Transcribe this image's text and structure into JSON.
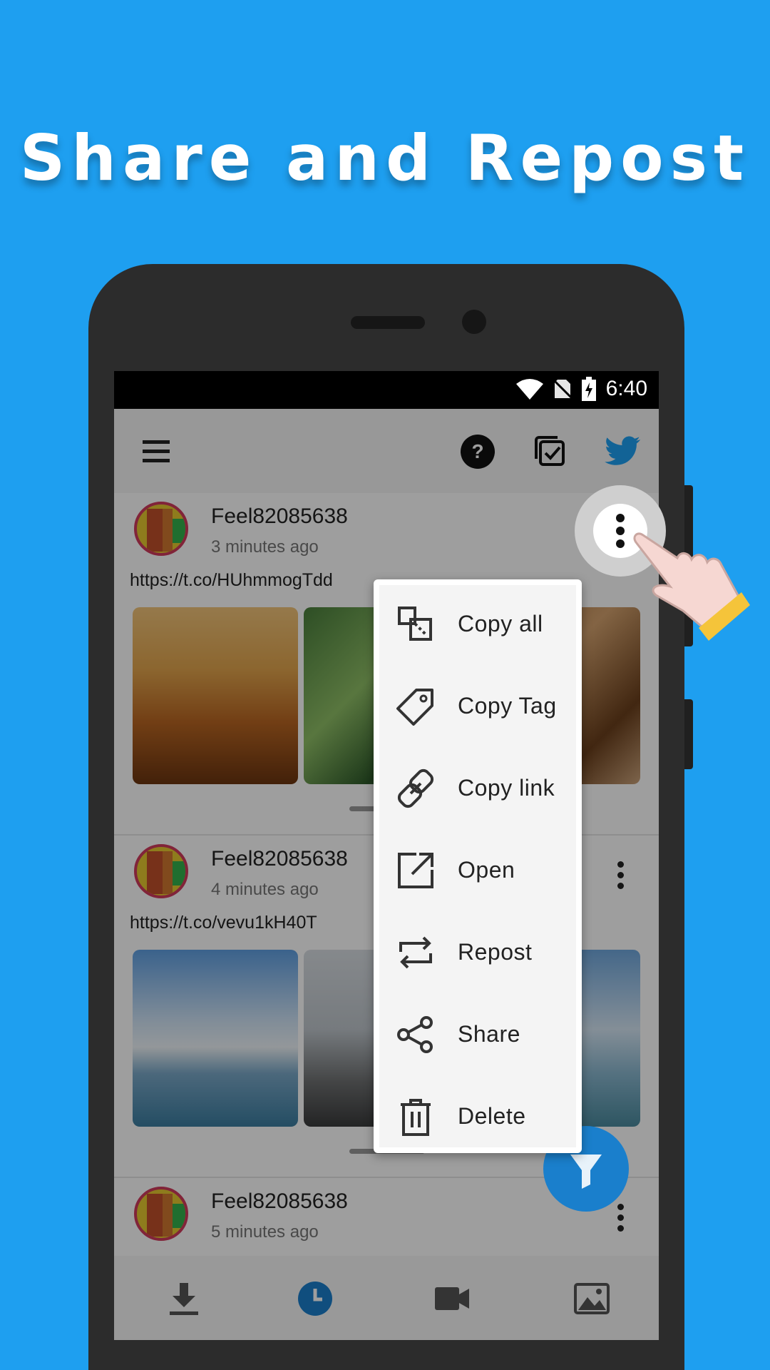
{
  "headline": "Share and Repost",
  "status": {
    "time": "6:40"
  },
  "toolbar": {
    "menu_icon": "hamburger-icon",
    "help_icon": "help-icon",
    "help_glyph": "?",
    "select_icon": "select-all-icon",
    "twitter_icon": "twitter-icon"
  },
  "posts": [
    {
      "user": "Feel82085638",
      "time": "3 minutes ago",
      "link": "https://t.co/HUhmmogTdd"
    },
    {
      "user": "Feel82085638",
      "time": "4 minutes ago",
      "link": "https://t.co/vevu1kH40T"
    },
    {
      "user": "Feel82085638",
      "time": "5 minutes ago",
      "link": ""
    }
  ],
  "menu": {
    "items": [
      {
        "label": "Copy all",
        "icon": "copy-all-icon"
      },
      {
        "label": "Copy Tag",
        "icon": "tag-icon"
      },
      {
        "label": "Copy link",
        "icon": "link-icon"
      },
      {
        "label": "Open",
        "icon": "open-external-icon"
      },
      {
        "label": "Repost",
        "icon": "repost-icon"
      },
      {
        "label": "Share",
        "icon": "share-icon"
      },
      {
        "label": "Delete",
        "icon": "trash-icon"
      }
    ]
  },
  "bottom_nav": [
    {
      "icon": "download-icon"
    },
    {
      "icon": "clock-icon",
      "active": true
    },
    {
      "icon": "video-icon"
    },
    {
      "icon": "image-icon"
    }
  ],
  "colors": {
    "background": "#1e9ff0",
    "accent": "#1a7fcc",
    "twitter": "#1da1f2"
  }
}
